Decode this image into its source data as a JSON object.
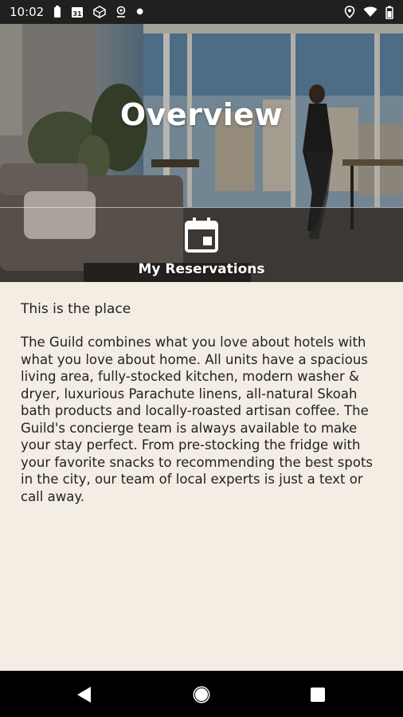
{
  "status_bar": {
    "time": "10:02",
    "calendar_day": "31",
    "icons": [
      "battery-saver-icon",
      "calendar-icon",
      "cube-icon",
      "location-pin-icon",
      "notification-dot",
      "location-icon",
      "wifi-icon",
      "battery-icon"
    ]
  },
  "hero": {
    "title": "Overview",
    "reservations_label": "My Reservations"
  },
  "content": {
    "heading": "This is the place",
    "body": "The Guild combines what you love about hotels with what you love about home. All units have a spacious living area, fully-stocked kitchen, modern washer & dryer, luxurious Parachute linens, all-natural Skoah bath products and locally-roasted artisan coffee. The Guild's concierge team is always available to make your stay perfect. From pre-stocking the fridge with your favorite snacks to recommending the best spots in the city, our team of local experts is just a text or call away."
  },
  "nav_bar": {
    "icons": [
      "back-icon",
      "home-icon",
      "recents-icon"
    ]
  },
  "colors": {
    "status_bar_bg": "#20201f",
    "content_bg": "#f3ede4",
    "nav_bar_bg": "#000000",
    "text": "#222222"
  }
}
